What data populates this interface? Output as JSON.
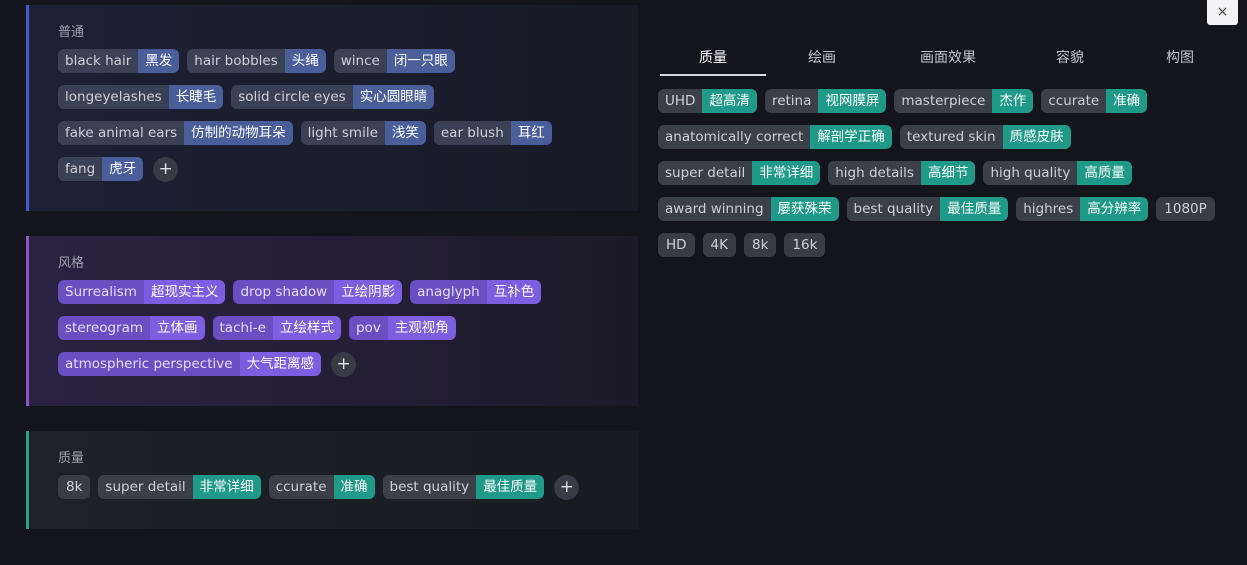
{
  "close_icon_glyph": "×",
  "add_glyph": "+",
  "colors": {
    "normal_accent": "#3b5bd8",
    "style_accent": "#8e55c8",
    "quality_accent": "#26a585"
  },
  "sections": {
    "normal": {
      "title": "普通",
      "tags": [
        {
          "en": "black hair",
          "cn": "黑发"
        },
        {
          "en": "hair bobbles",
          "cn": "头绳"
        },
        {
          "en": "wince",
          "cn": "闭一只眼"
        },
        {
          "en": "longeyelashes",
          "cn": "长睫毛"
        },
        {
          "en": "solid circle eyes",
          "cn": "实心圆眼睛"
        },
        {
          "en": "fake animal ears",
          "cn": "仿制的动物耳朵"
        },
        {
          "en": "light smile",
          "cn": "浅笑"
        },
        {
          "en": "ear blush",
          "cn": "耳红"
        },
        {
          "en": "fang",
          "cn": "虎牙"
        }
      ]
    },
    "style": {
      "title": "风格",
      "tags": [
        {
          "en": "Surrealism",
          "cn": "超现实主义"
        },
        {
          "en": "drop shadow",
          "cn": "立绘阴影"
        },
        {
          "en": "anaglyph",
          "cn": "互补色"
        },
        {
          "en": "stereogram",
          "cn": "立体画"
        },
        {
          "en": "tachi-e",
          "cn": "立绘样式"
        },
        {
          "en": "pov",
          "cn": "主观视角"
        },
        {
          "en": "atmospheric perspective",
          "cn": "大气距离感"
        }
      ]
    },
    "quality": {
      "title": "质量",
      "tags": [
        {
          "en": "8k",
          "cn": ""
        },
        {
          "en": "super detail",
          "cn": "非常详细"
        },
        {
          "en": "ccurate",
          "cn": "准确"
        },
        {
          "en": "best quality",
          "cn": "最佳质量"
        }
      ]
    }
  },
  "library": {
    "tabs": [
      {
        "label": "质量",
        "active": true
      },
      {
        "label": "绘画",
        "active": false
      },
      {
        "label": "画面效果",
        "active": false
      },
      {
        "label": "容貌",
        "active": false
      },
      {
        "label": "构图",
        "active": false
      }
    ],
    "tags": [
      {
        "en": "UHD",
        "cn": "超高清"
      },
      {
        "en": "retina",
        "cn": "视网膜屏"
      },
      {
        "en": "masterpiece",
        "cn": "杰作"
      },
      {
        "en": "ccurate",
        "cn": "准确"
      },
      {
        "en": "anatomically correct",
        "cn": "解剖学正确"
      },
      {
        "en": "textured skin",
        "cn": "质感皮肤"
      },
      {
        "en": "super detail",
        "cn": "非常详细"
      },
      {
        "en": "high details",
        "cn": "高细节"
      },
      {
        "en": "high quality",
        "cn": "高质量"
      },
      {
        "en": "award winning",
        "cn": "屡获殊荣"
      },
      {
        "en": "best quality",
        "cn": "最佳质量"
      },
      {
        "en": "highres",
        "cn": "高分辨率"
      },
      {
        "en": "1080P",
        "cn": ""
      },
      {
        "en": "HD",
        "cn": ""
      },
      {
        "en": "4K",
        "cn": ""
      },
      {
        "en": "8k",
        "cn": ""
      },
      {
        "en": "16k",
        "cn": ""
      }
    ]
  }
}
